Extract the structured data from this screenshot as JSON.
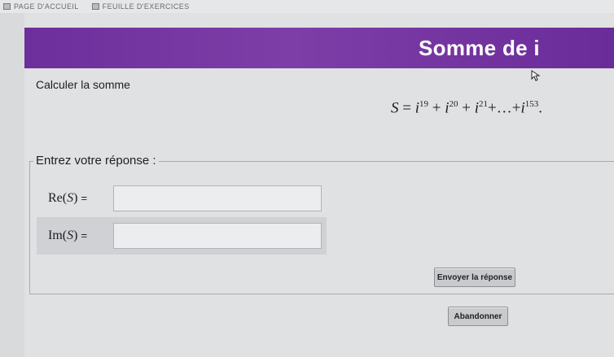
{
  "topbar": {
    "home_link": "PAGE D'ACCUEIL",
    "sheet_link": "FEUILLE D'EXERCICES"
  },
  "exercise": {
    "title": "Somme de i",
    "prompt": "Calculer la somme",
    "formula": {
      "lhs": "S",
      "eq": "=",
      "base": "i",
      "exponents": [
        "19",
        "20",
        "21",
        "153"
      ],
      "ellipsis": "…"
    }
  },
  "answer": {
    "legend": "Entrez votre réponse :",
    "fields": [
      {
        "func": "Re",
        "var": "S",
        "value": ""
      },
      {
        "func": "Im",
        "var": "S",
        "value": ""
      }
    ],
    "submit_label": "Envoyer la réponse",
    "abandon_label": "Abandonner"
  },
  "colors": {
    "banner": "#7a3aa6",
    "page_background": "#e0e1e3"
  }
}
